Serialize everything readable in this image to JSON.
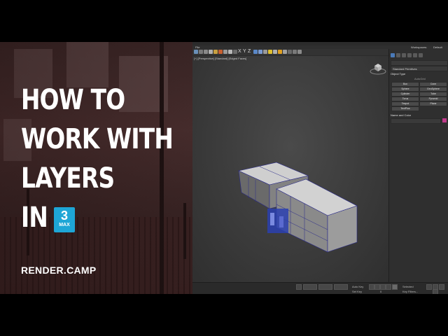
{
  "headline": {
    "line1": "HOW TO",
    "line2": "WORK WITH",
    "line3": "LAYERS",
    "line4": "IN"
  },
  "badge": {
    "number": "3",
    "label": "MAX"
  },
  "brand": "RENDER.CAMP",
  "app": {
    "menu": [
      "File"
    ],
    "workspace_label": "Workspaces:",
    "workspace_value": "Default",
    "toolbar_letters": [
      "X",
      "Y",
      "Z"
    ],
    "viewport_label": "[+] [Perspective] [Standard] [Edged Faces]",
    "command_panel": {
      "category": "Standard Primitives",
      "object_type_title": "Object Type",
      "autogrid": "AutoGrid",
      "objects": [
        "Box",
        "Cone",
        "Sphere",
        "GeoSphere",
        "Cylinder",
        "Tube",
        "Torus",
        "Pyramid",
        "Teapot",
        "Plane",
        "TextPlus"
      ],
      "name_color_title": "Name and Color"
    },
    "bottom": {
      "frame_value": "0",
      "autokey": "Auto Key",
      "setkey": "Set Key",
      "selected": "Selected",
      "key_filters": "Key Filters..."
    }
  }
}
